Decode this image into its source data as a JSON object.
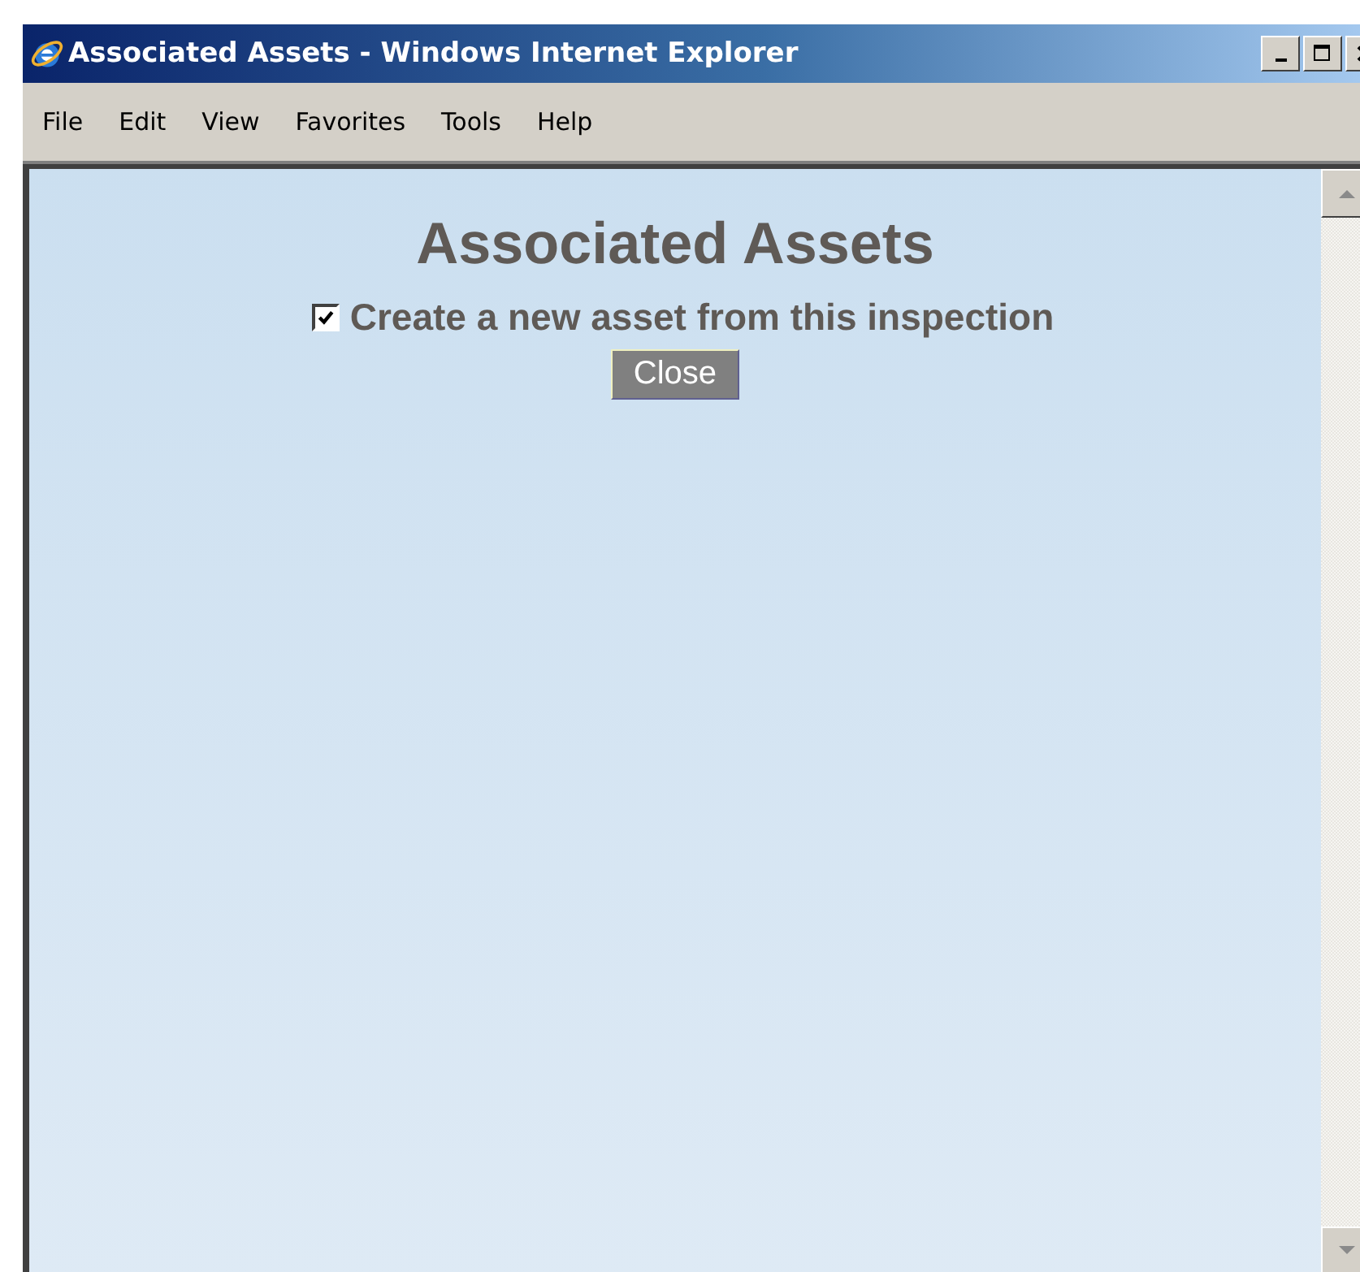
{
  "window": {
    "title": "Associated Assets - Windows Internet Explorer"
  },
  "menu": [
    {
      "label": "File"
    },
    {
      "label": "Edit"
    },
    {
      "label": "View"
    },
    {
      "label": "Favorites"
    },
    {
      "label": "Tools"
    },
    {
      "label": "Help"
    }
  ],
  "page": {
    "heading": "Associated Assets",
    "checkbox": {
      "label": "Create a new asset from this inspection",
      "checked": true
    },
    "button": "Close"
  }
}
